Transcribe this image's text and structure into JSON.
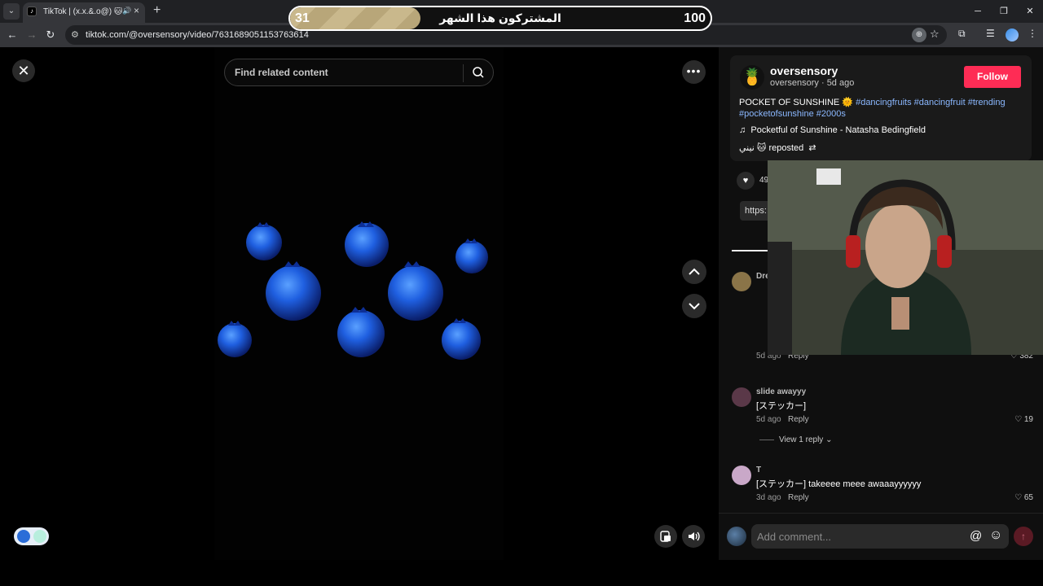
{
  "browser": {
    "tab_title": "TikTok | (x.x.&.o@) 🐱 نيني",
    "url": "tiktok.com/@oversensory/video/7631689051153763614"
  },
  "overlay": {
    "subscriber_count": "31",
    "subscriber_goal": "100",
    "subscriber_progress": 0.31,
    "label": "المشتركون هذا الشهر"
  },
  "video": {
    "search_placeholder": "Find related content"
  },
  "post": {
    "author_name": "oversensory",
    "author_meta": "oversensory · 5d ago",
    "follow_label": "Follow",
    "description_prefix": "POCKET OF SUNSHINE 🌞 ",
    "hashtags": [
      "#dancingfruits",
      "#dancingfruit",
      "#trending",
      "#pocketofsunshine",
      "#2000s"
    ],
    "music": "Pocketful of Sunshine - Natasha Bedingfield",
    "repost_user": "نيني 🐱",
    "repost_label": "reposted",
    "like_count_partial": "49",
    "link_partial": "https:"
  },
  "comments": [
    {
      "user": "Dre",
      "text": "",
      "time": "5d ago",
      "reply": "Reply",
      "likes": "382",
      "avatar_color": "#8a7448"
    },
    {
      "user": "slide awayyy",
      "text": "[ステッカー]",
      "time": "5d ago",
      "reply": "Reply",
      "likes": "19",
      "avatar_color": "#5a3848"
    },
    {
      "user": "T",
      "text": "[ステッカー] takeeee meee awaaayyyyyy",
      "time": "3d ago",
      "reply": "Reply",
      "likes": "65",
      "avatar_color": "#c9a8c8"
    }
  ],
  "view_replies": "View 1 reply",
  "comment_input": {
    "placeholder": "Add comment..."
  },
  "colors": {
    "follow": "#fe2c55",
    "hashtag": "#8bb8ff",
    "panel_bg": "#0f0f0f"
  }
}
